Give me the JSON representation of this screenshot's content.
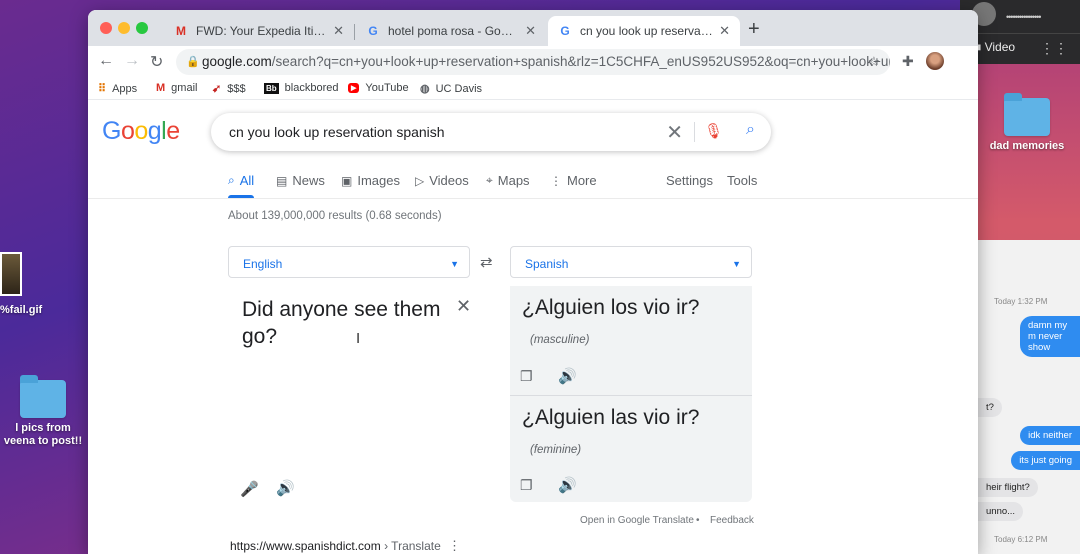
{
  "desktop": {
    "icons": [
      {
        "label": "dad memories"
      },
      {
        "label": "%fail.gif"
      },
      {
        "label": "l pics from veena to post!!"
      }
    ]
  },
  "video_call": {
    "name": "••••••••••••••••",
    "button": "Video"
  },
  "messages": {
    "stamp1": "Today 1:32 PM",
    "out1": "damn my m never show",
    "in1": "t?",
    "out2": "idk neither",
    "out3": "its just going",
    "in2": "heir flight?",
    "in3": "unno...",
    "stamp2": "Today 6:12 PM"
  },
  "browser": {
    "tabs": [
      {
        "favicon": "M",
        "title": "FWD: Your Expedia Itinerary for"
      },
      {
        "favicon": "G",
        "title": "hotel poma rosa - Google Search"
      },
      {
        "favicon": "G",
        "title": "cn you look up reservation spanish"
      }
    ],
    "url_host": "google.com",
    "url_rest": "/search?q=cn+you+look+up+reservation+spanish&rlz=1C5CHFA_enUS952US952&oq=cn+you+look+up+rese...",
    "bookmarks": [
      {
        "icon": "apps-icon",
        "label": "Apps"
      },
      {
        "icon": "gmail-icon",
        "label": "gmail"
      },
      {
        "icon": "money-icon",
        "label": "$$$"
      },
      {
        "icon": "blackboard-icon",
        "label": "blackbored"
      },
      {
        "icon": "youtube-icon",
        "label": "YouTube"
      },
      {
        "icon": "ucdavis-icon",
        "label": "UC Davis"
      }
    ]
  },
  "google": {
    "logo": "Google",
    "query": "cn you look up reservation spanish",
    "tabs": [
      "All",
      "News",
      "Images",
      "Videos",
      "Maps",
      "More",
      "Settings",
      "Tools"
    ],
    "stats": "About 139,000,000 results (0.68 seconds)",
    "translate": {
      "source_lang": "English",
      "target_lang": "Spanish",
      "source_text": "Did anyone see them go?",
      "results": [
        {
          "text": "¿Alguien los vio ir?",
          "gender": "(masculine)"
        },
        {
          "text": "¿Alguien las vio ir?",
          "gender": "(feminine)"
        }
      ],
      "open_link": "Open in Google Translate",
      "dot": "•",
      "feedback": "Feedback"
    },
    "result_url": "https://www.spanishdict.com",
    "result_crumb": " › Translate"
  },
  "colors": {
    "accent": "#1a73e8",
    "bubble": "#2f8cf0"
  }
}
